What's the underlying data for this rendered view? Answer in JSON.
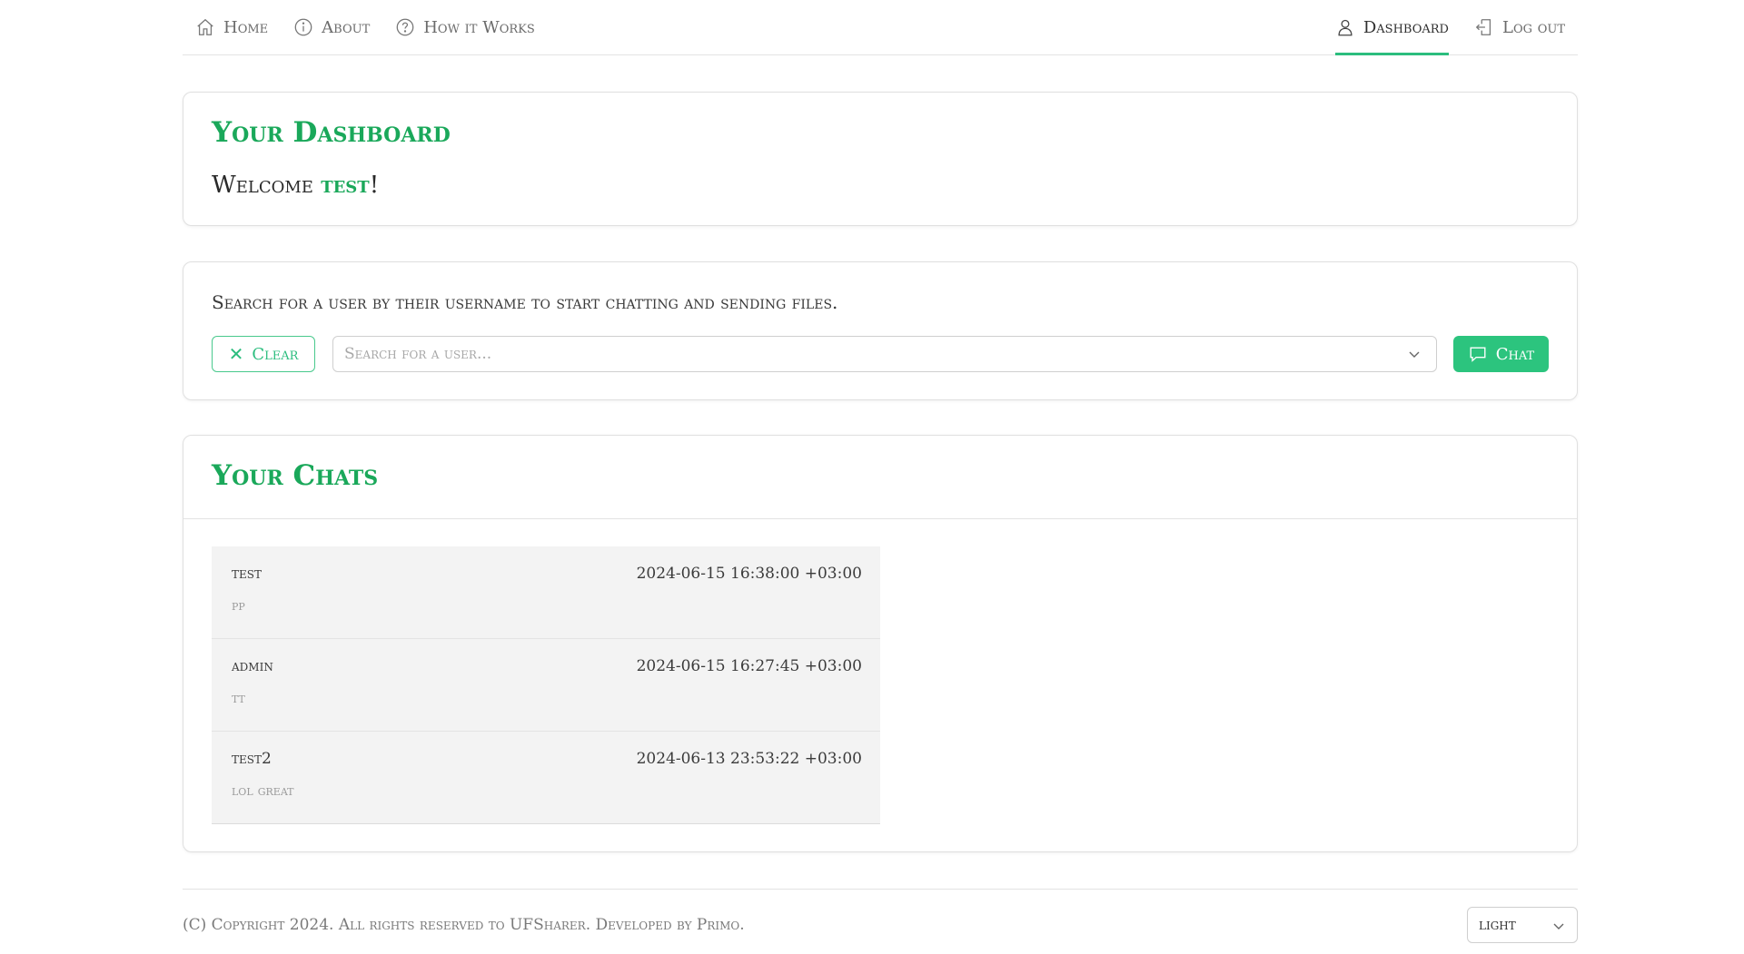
{
  "nav": {
    "left": [
      {
        "label": "Home",
        "icon": "home-icon"
      },
      {
        "label": "About",
        "icon": "info-icon"
      },
      {
        "label": "How it Works",
        "icon": "question-icon"
      }
    ],
    "right": [
      {
        "label": "Dashboard",
        "icon": "user-icon",
        "active": true
      },
      {
        "label": "Log out",
        "icon": "logout-icon"
      }
    ]
  },
  "dashboard": {
    "title": "Your Dashboard",
    "welcome_prefix": "Welcome ",
    "username": "test",
    "welcome_suffix": "!"
  },
  "search": {
    "description": "Search for a user by their username to start chatting and sending files.",
    "clear_label": "Clear",
    "placeholder": "Search for a user...",
    "chat_label": "Chat"
  },
  "chats": {
    "title": "Your Chats",
    "items": [
      {
        "name": "test",
        "time": "2024-06-15 16:38:00 +03:00",
        "message": "pp"
      },
      {
        "name": "admin",
        "time": "2024-06-15 16:27:45 +03:00",
        "message": "tt"
      },
      {
        "name": "test2",
        "time": "2024-06-13 23:53:22 +03:00",
        "message": "lol great"
      }
    ]
  },
  "footer": {
    "copyright": "(C) Copyright 2024. All rights reserved to UFSharer. Developed by Primo.",
    "theme": "light"
  },
  "colors": {
    "accent": "#2bbd7e",
    "title_green": "#1aa85a",
    "chat_item_bg": "#f3f3f3"
  }
}
